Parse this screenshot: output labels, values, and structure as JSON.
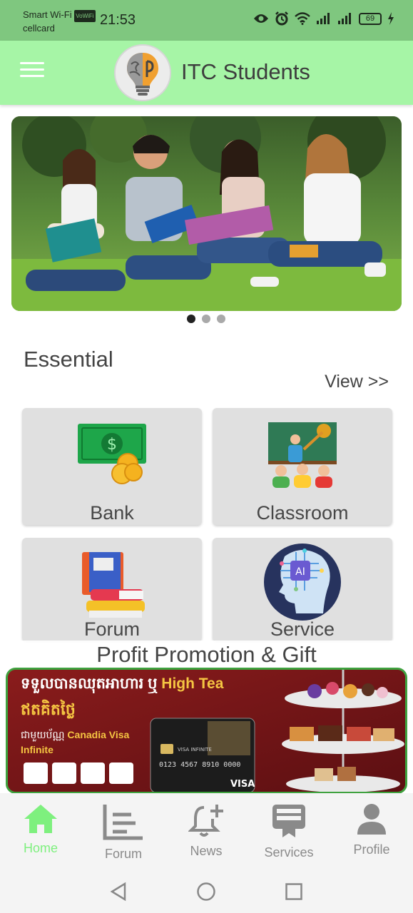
{
  "status_bar": {
    "carrier_line1": "Smart Wi-Fi",
    "wifi_tag": "VoWiFi",
    "carrier_line2": "cellcard",
    "time": "21:53",
    "battery": "69",
    "icons": [
      "eye-icon",
      "alarm-icon",
      "wifi-icon",
      "signal-icon",
      "signal-icon",
      "battery-icon",
      "charging-icon"
    ]
  },
  "app_bar": {
    "title": "ITC Students",
    "menu_icon": "hamburger-icon",
    "logo": "brain-bulb-logo"
  },
  "carousel": {
    "slide_count": 3,
    "active_index": 0
  },
  "essential": {
    "title": "Essential",
    "view_label": "View >>",
    "cards": [
      {
        "label": "Bank",
        "icon": "money-icon"
      },
      {
        "label": "Classroom",
        "icon": "classroom-icon"
      },
      {
        "label": "Forum",
        "icon": "books-icon"
      },
      {
        "label": "Service",
        "icon": "ai-head-icon"
      }
    ]
  },
  "promo": {
    "title": "Profit Promotion & Gift",
    "banner_line1_khmer": "ទទួលបានឈុតអាហារ ឬ",
    "banner_line1_en": "High Tea",
    "banner_line2_khmer": "ឥតគិតថ្លៃ",
    "banner_line3_khmer": "ជាមួយប័ណ្ណ",
    "banner_line3_en": "Canadia Visa",
    "banner_line4_en": "Infinite",
    "card_number": "0123 4567 8910 0000",
    "card_brand": "VISA",
    "card_tier": "VISA INFINITE"
  },
  "bottom_nav": [
    {
      "label": "Home",
      "icon": "home-icon",
      "active": true
    },
    {
      "label": "Forum",
      "icon": "forum-icon",
      "active": false
    },
    {
      "label": "News",
      "icon": "bell-plus-icon",
      "active": false
    },
    {
      "label": "Services",
      "icon": "services-icon",
      "active": false
    },
    {
      "label": "Profile",
      "icon": "person-icon",
      "active": false
    }
  ],
  "colors": {
    "status_bar": "#7fc77f",
    "app_bar": "#a6f5a6",
    "nav_active": "#7ef07e",
    "nav_inactive": "#8a8a8a",
    "promo_border": "#3fa23f",
    "promo_bg": "#8f1f1f"
  }
}
